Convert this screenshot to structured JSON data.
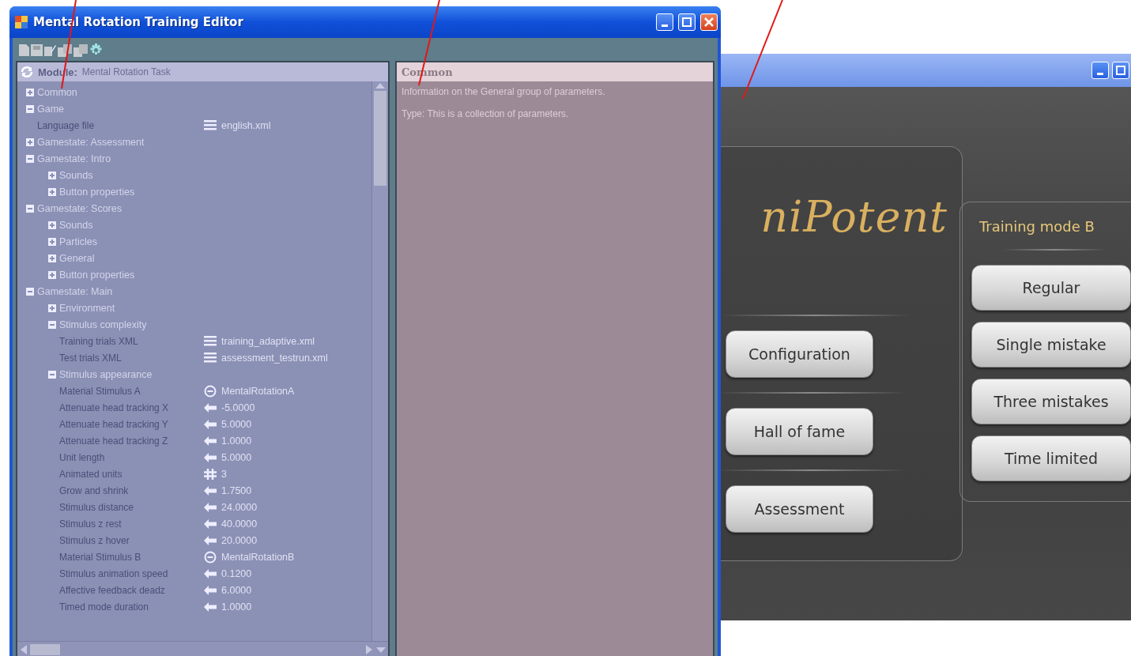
{
  "editor": {
    "title": "Mental Rotation Training Editor",
    "module": {
      "label": "Module:",
      "value": "Mental Rotation Task"
    },
    "tree": [
      {
        "label": "Common",
        "expanded": false
      },
      {
        "label": "Game",
        "expanded": true,
        "children": [
          {
            "label": "Language file",
            "value": "english.xml",
            "kind": "file"
          }
        ]
      },
      {
        "label": "Gamestate: Assessment",
        "expanded": false
      },
      {
        "label": "Gamestate: Intro",
        "expanded": true,
        "children": [
          {
            "label": "Sounds",
            "expanded": false
          },
          {
            "label": "Button properties",
            "expanded": false
          }
        ]
      },
      {
        "label": "Gamestate: Scores",
        "expanded": true,
        "children": [
          {
            "label": "Sounds",
            "expanded": false
          },
          {
            "label": "Particles",
            "expanded": false
          },
          {
            "label": "General",
            "expanded": false
          },
          {
            "label": "Button properties",
            "expanded": false
          }
        ]
      },
      {
        "label": "Gamestate: Main",
        "expanded": true,
        "children": [
          {
            "label": "Environment",
            "expanded": false
          },
          {
            "label": "Stimulus complexity",
            "expanded": true,
            "children": [
              {
                "label": "Training trials XML",
                "value": "training_adaptive.xml",
                "kind": "file"
              },
              {
                "label": "Test trials XML",
                "value": "assessment_testrun.xml",
                "kind": "file"
              }
            ]
          },
          {
            "label": "Stimulus appearance",
            "expanded": true,
            "children": [
              {
                "label": "Material Stimulus A",
                "value": "MentalRotationA",
                "kind": "material"
              },
              {
                "label": "Attenuate head tracking X",
                "value": "-5.0000",
                "kind": "number"
              },
              {
                "label": "Attenuate head tracking Y",
                "value": "5.0000",
                "kind": "number"
              },
              {
                "label": "Attenuate head tracking Z",
                "value": "1.0000",
                "kind": "number"
              },
              {
                "label": "Unit length",
                "value": "5.0000",
                "kind": "number"
              },
              {
                "label": "Animated units",
                "value": "3",
                "kind": "integer"
              },
              {
                "label": "Grow and shrink",
                "value": "1.7500",
                "kind": "number"
              },
              {
                "label": "Stimulus distance",
                "value": "24.0000",
                "kind": "number"
              },
              {
                "label": "Stimulus z rest",
                "value": "40.0000",
                "kind": "number"
              },
              {
                "label": "Stimulus z hover",
                "value": "20.0000",
                "kind": "number"
              },
              {
                "label": "Material Stimulus B",
                "value": "MentalRotationB",
                "kind": "material"
              },
              {
                "label": "Stimulus animation speed",
                "value": "0.1200",
                "kind": "number"
              },
              {
                "label": "Affective feedback deadz",
                "value": "6.0000",
                "kind": "number"
              },
              {
                "label": "Timed mode duration",
                "value": "1.0000",
                "kind": "number"
              }
            ]
          }
        ]
      }
    ],
    "details": {
      "title": "Common",
      "paragraphs": [
        "Information on the General group of parameters.",
        "Type: This is a collection of parameters."
      ]
    }
  },
  "game_window": {
    "logo": "niPotent",
    "menu_buttons": [
      "Configuration",
      "Hall of fame",
      "Assessment"
    ],
    "mode_panel": {
      "title": "Training mode B",
      "buttons": [
        "Regular",
        "Single mistake",
        "Three mistakes",
        "Time limited"
      ]
    }
  }
}
